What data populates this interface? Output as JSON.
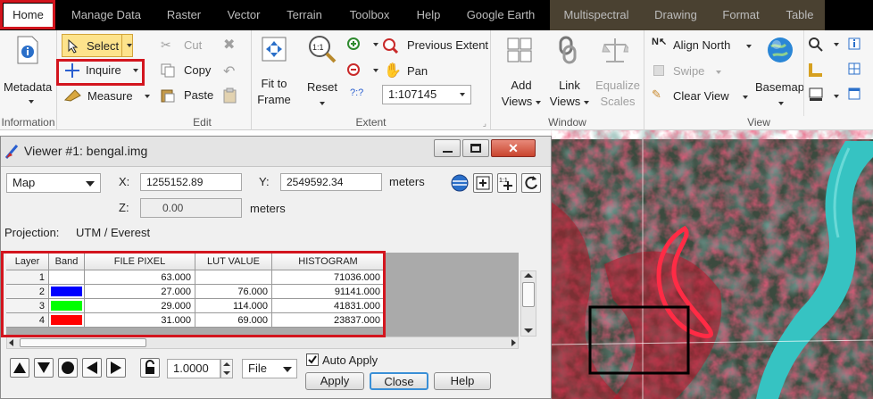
{
  "tabs": [
    "Home",
    "Manage Data",
    "Raster",
    "Vector",
    "Terrain",
    "Toolbox",
    "Help",
    "Google Earth",
    "Multispectral",
    "Drawing",
    "Format",
    "Table"
  ],
  "ribbon": {
    "information": {
      "label": "Information",
      "metadata": "Metadata"
    },
    "select": "Select",
    "inquire": "Inquire",
    "measure": "Measure",
    "edit": {
      "label": "Edit",
      "cut": "Cut",
      "copy": "Copy",
      "paste": "Paste"
    },
    "extent": {
      "label": "Extent",
      "fit1": "Fit to",
      "fit2": "Frame",
      "reset": "Reset",
      "previous_extent": "Previous Extent",
      "pan": "Pan",
      "scale": "1:107145",
      "help_glyph": "?:?"
    },
    "window": {
      "label": "Window",
      "add1": "Add",
      "add2": "Views",
      "link1": "Link",
      "link2": "Views",
      "eq1": "Equalize",
      "eq2": "Scales"
    },
    "view": {
      "label": "View",
      "align_north": "Align North",
      "swipe": "Swipe",
      "clear_view": "Clear View",
      "basemap": "Basemap"
    }
  },
  "viewer": {
    "title": "Viewer #1:  bengal.img",
    "coord_type": "Map",
    "x_label": "X:",
    "x_value": "1255152.89",
    "y_label": "Y:",
    "y_value": "2549592.34",
    "z_label": "Z:",
    "z_value": "0.00",
    "unit_xy": "meters",
    "unit_z": "meters",
    "projection_label": "Projection:",
    "projection_value": "UTM / Everest",
    "table": {
      "headers": [
        "Layer",
        "Band",
        "FILE PIXEL",
        "LUT VALUE",
        "HISTOGRAM"
      ],
      "rows": [
        {
          "layer": "1",
          "band_color": "#ffffff",
          "file_pixel": "63.000",
          "lut": "",
          "hist": "71036.000"
        },
        {
          "layer": "2",
          "band_color": "#0000ff",
          "file_pixel": "27.000",
          "lut": "76.000",
          "hist": "91141.000"
        },
        {
          "layer": "3",
          "band_color": "#00ff00",
          "file_pixel": "29.000",
          "lut": "114.000",
          "hist": "41831.000"
        },
        {
          "layer": "4",
          "band_color": "#ff0000",
          "file_pixel": "31.000",
          "lut": "69.000",
          "hist": "23837.000"
        }
      ]
    },
    "step_value": "1.0000",
    "file_menu": "File",
    "auto_apply": "Auto Apply",
    "apply": "Apply",
    "close": "Close",
    "help": "Help"
  },
  "colors": {
    "highlight": "#d3151e",
    "tab_bar": "#000000",
    "context_tab": "#4a4131"
  }
}
